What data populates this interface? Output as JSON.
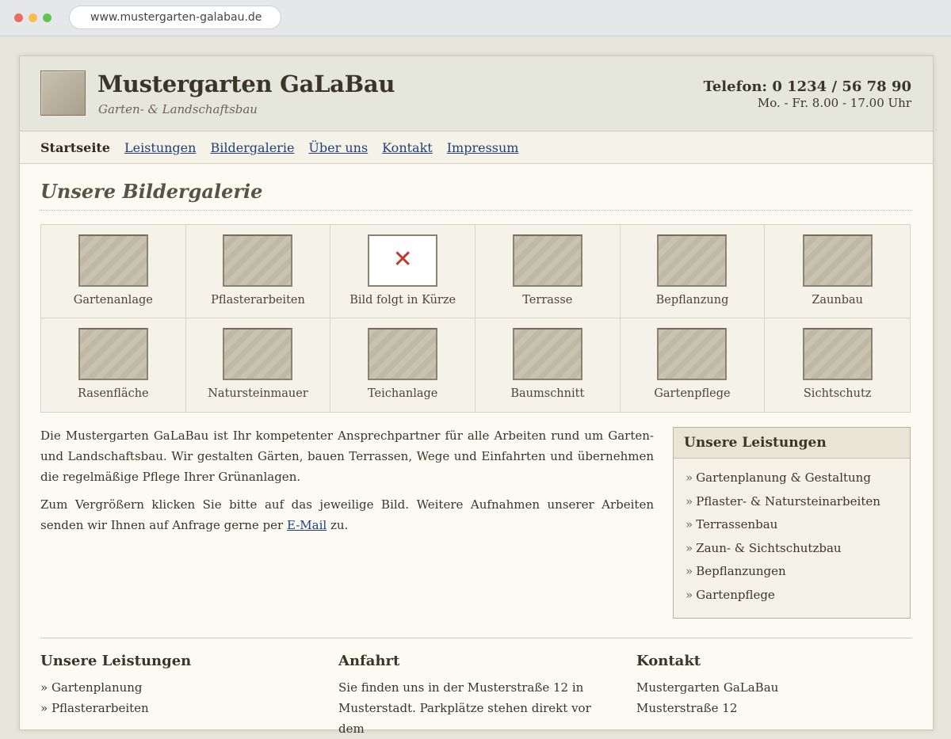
{
  "browser": {
    "url": "www.mustergarten-galabau.de"
  },
  "header": {
    "title": "Mustergarten GaLaBau",
    "subtitle": "Garten- & Landschaftsbau",
    "phone": "Telefon: 0 1234 / 56 78 90",
    "hours": "Mo. - Fr. 8.00 - 17.00 Uhr"
  },
  "nav": {
    "items": [
      {
        "label": "Startseite",
        "active": true
      },
      {
        "label": "Leistungen"
      },
      {
        "label": "Bildergalerie"
      },
      {
        "label": "Über uns"
      },
      {
        "label": "Kontakt"
      },
      {
        "label": "Impressum"
      }
    ]
  },
  "main": {
    "heading": "Unsere Bildergalerie",
    "gallery": [
      {
        "caption": "Gartenanlage"
      },
      {
        "caption": "Pflasterarbeiten"
      },
      {
        "caption": "Bild folgt in Kürze",
        "placeholder": true,
        "icon": "close-icon"
      },
      {
        "caption": "Terrasse"
      },
      {
        "caption": "Bepflanzung"
      },
      {
        "caption": "Zaunbau"
      },
      {
        "caption": "Rasenfläche"
      },
      {
        "caption": "Natursteinmauer"
      },
      {
        "caption": "Teichanlage"
      },
      {
        "caption": "Baumschnitt"
      },
      {
        "caption": "Gartenpflege"
      },
      {
        "caption": "Sichtschutz"
      }
    ],
    "intro_p1": "Die Mustergarten GaLaBau ist Ihr kompetenter Ansprechpartner für alle Arbeiten rund um Garten- und Landschaftsbau. Wir gestalten Gärten, bauen Terrassen, Wege und Einfahrten und übernehmen die regelmäßige Pflege Ihrer Grünanlagen.",
    "intro_p2_before": "Zum Vergrößern klicken Sie bitte auf das jeweilige Bild. Weitere Aufnahmen unserer Arbeiten senden wir Ihnen auf Anfrage gerne per ",
    "intro_p2_link": "E-Mail",
    "intro_p2_after": " zu."
  },
  "sidebar": {
    "title": "Unsere Leistungen",
    "items": [
      "Gartenplanung & Gestaltung",
      "Pflaster- & Natursteinarbeiten",
      "Terrassenbau",
      "Zaun- & Sichtschutzbau",
      "Bepflanzungen",
      "Gartenpflege"
    ]
  },
  "footer": {
    "col1": {
      "title": "Unsere Leistungen",
      "lines": [
        "» Gartenplanung",
        "» Pflasterarbeiten"
      ]
    },
    "col2": {
      "title": "Anfahrt",
      "lines": [
        "Sie finden uns in der Musterstraße 12 in",
        "Musterstadt. Parkplätze stehen direkt vor dem"
      ]
    },
    "col3": {
      "title": "Kontakt",
      "lines": [
        "Mustergarten GaLaBau",
        "Musterstraße 12"
      ]
    }
  },
  "colors": {
    "link": "#1f3e7a",
    "header_bg": "#e6e7dc",
    "page_bg": "#fbfaf3",
    "placeholder_x": "#c0392b"
  }
}
